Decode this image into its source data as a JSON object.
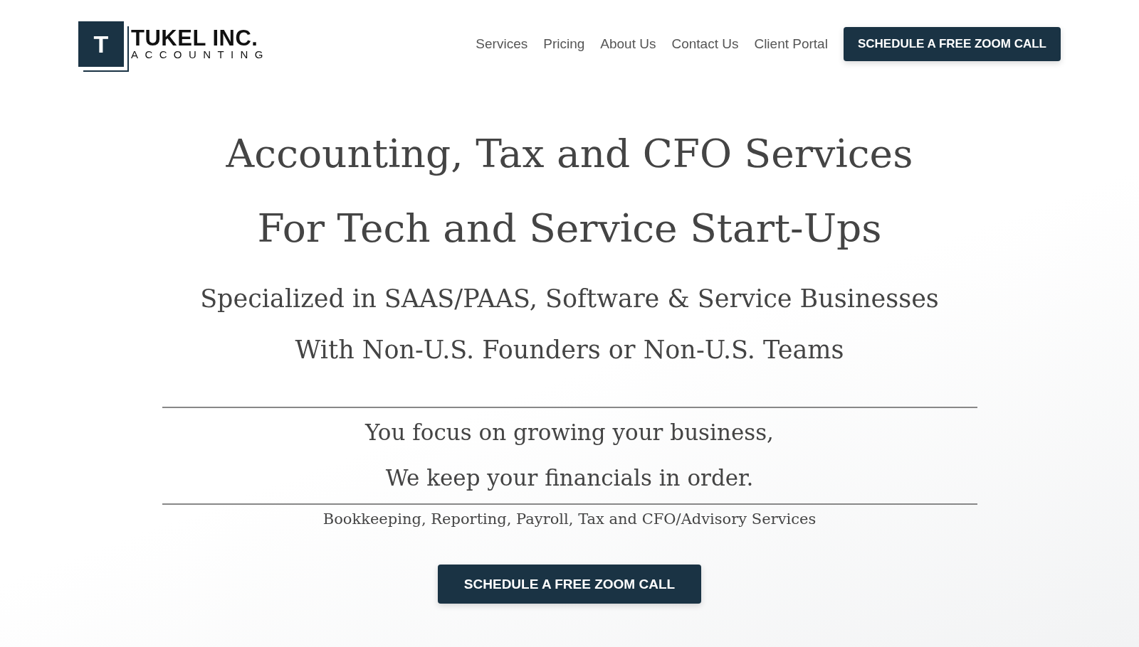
{
  "logo": {
    "mark": "T",
    "name": "TUKEL INC.",
    "tagline": "ACCOUNTING"
  },
  "nav": {
    "links": [
      "Services",
      "Pricing",
      "About Us",
      "Contact Us",
      "Client Portal"
    ],
    "cta": "SCHEDULE A FREE ZOOM CALL"
  },
  "hero": {
    "headlines": [
      "Accounting, Tax and CFO Services",
      "For Tech and Service Start-Ups"
    ],
    "subheadlines": [
      "Specialized in SAAS/PAAS, Software & Service Businesses",
      "With Non-U.S. Founders or Non-U.S. Teams"
    ],
    "taglines": [
      "You focus on growing your business,",
      "We keep your financials in order."
    ],
    "services": "Bookkeeping, Reporting, Payroll, Tax and CFO/Advisory Services",
    "cta": "SCHEDULE A FREE ZOOM CALL"
  }
}
